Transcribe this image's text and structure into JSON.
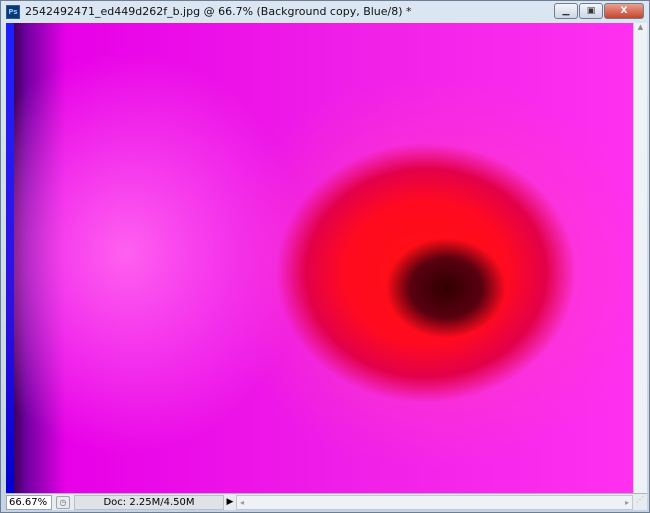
{
  "window": {
    "title": "2542492471_ed449d262f_b.jpg @ 66.7% (Background copy, Blue/8) *",
    "app_icon": "Ps"
  },
  "controls": {
    "minimize": "▁",
    "maximize": "▣",
    "close": "X"
  },
  "status": {
    "zoom": "66.67%",
    "doc": "Doc: 2.25M/4.50M"
  }
}
